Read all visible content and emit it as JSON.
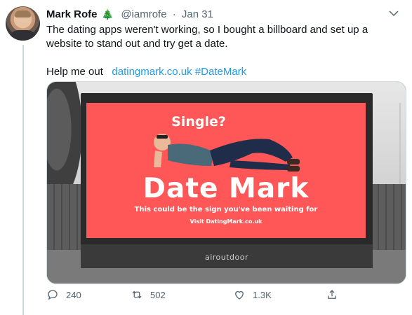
{
  "tweet": {
    "author_name": "Mark Rofe",
    "author_emoji": "🎄",
    "handle": "@iamrofe",
    "separator": "·",
    "date": "Jan 31",
    "text_line1": "The dating apps weren't working, so I bought a billboard and set up a website to stand out and try get a date.",
    "text_line2_prefix": "Help me out",
    "link": "datingmark.co.uk",
    "hashtag": "#DateMark"
  },
  "billboard": {
    "headline": "Single?",
    "title": "Date Mark",
    "tagline": "This could be the sign you've been waiting for",
    "visit": "Visit DatingMark.co.uk",
    "brand": "airoutdoor",
    "panel_color": "#ff5757"
  },
  "actions": {
    "replies": "240",
    "retweets": "502",
    "likes": "1.3K"
  },
  "icons": {
    "more": "chevron-down-icon",
    "reply": "reply-icon",
    "retweet": "retweet-icon",
    "like": "heart-icon",
    "share": "share-icon"
  },
  "colors": {
    "link": "#1d9bf0",
    "secondary_text": "#536471"
  }
}
